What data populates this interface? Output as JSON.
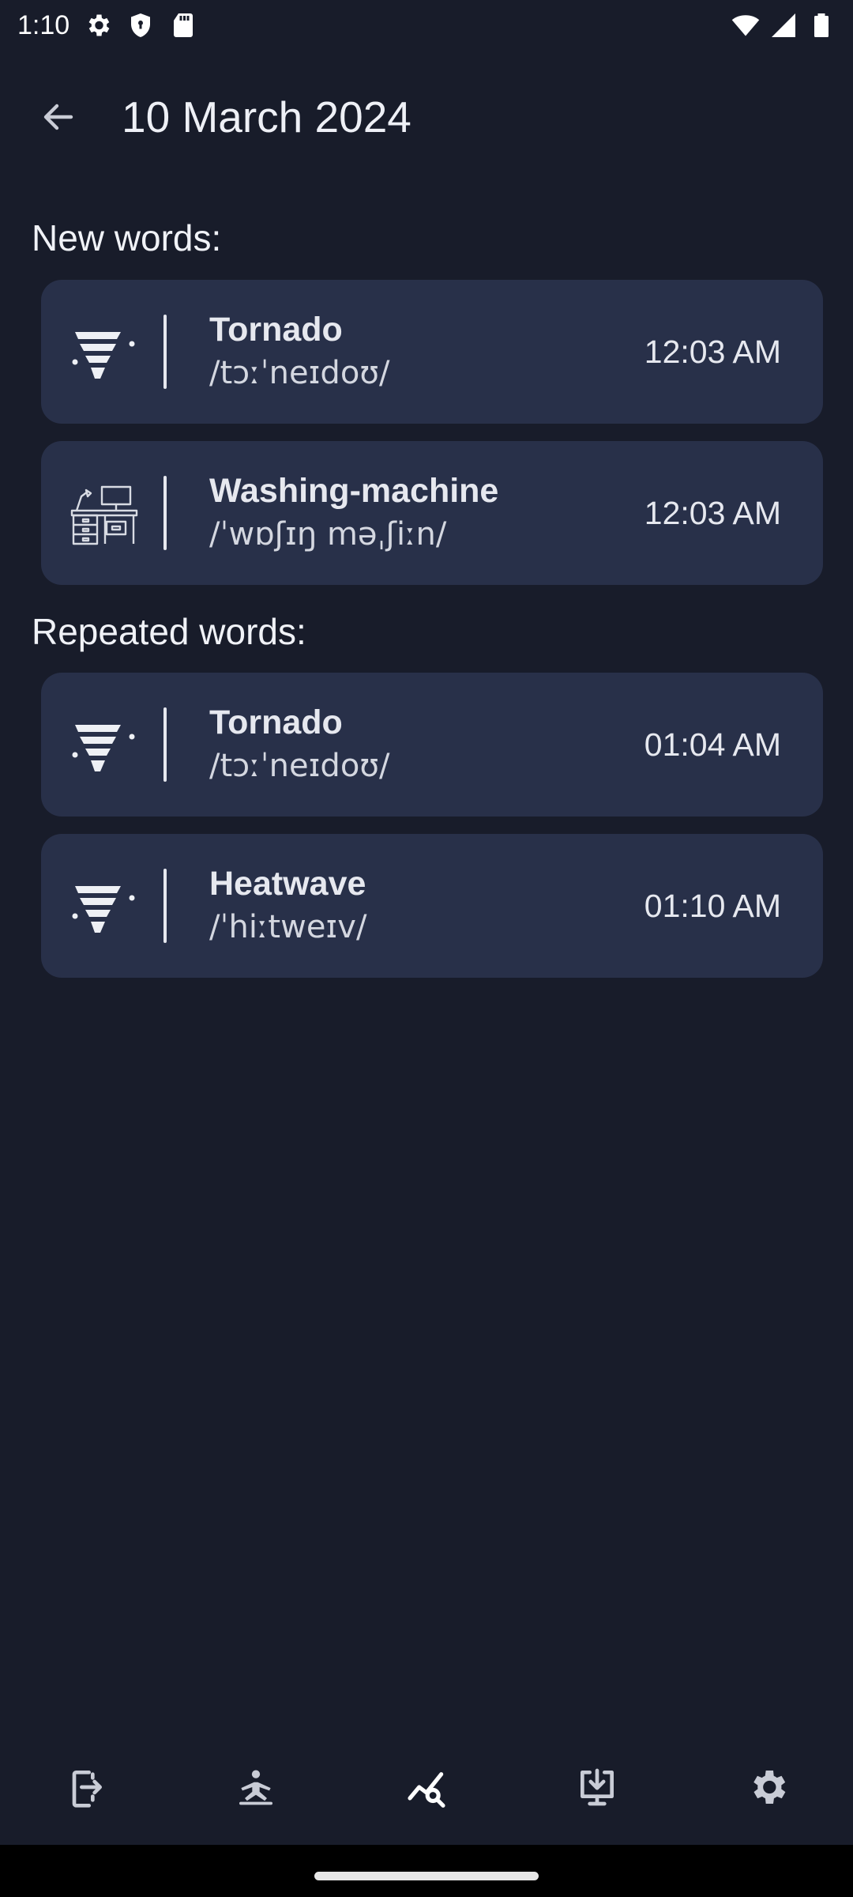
{
  "status_bar": {
    "time": "1:10"
  },
  "header": {
    "title": "10 March 2024"
  },
  "sections": {
    "new_label": "New words:",
    "repeated_label": "Repeated words:"
  },
  "new_words": [
    {
      "word": "Tornado",
      "phonetic": "/tɔːˈneɪdoʊ/",
      "time": "12:03 AM",
      "icon": "tornado-icon"
    },
    {
      "word": "Washing-machine",
      "phonetic": "/ˈwɒʃɪŋ məˌʃiːn/",
      "time": "12:03 AM",
      "icon": "furniture-icon"
    }
  ],
  "repeated_words": [
    {
      "word": "Tornado",
      "phonetic": "/tɔːˈneɪdoʊ/",
      "time": "01:04 AM",
      "icon": "tornado-icon"
    },
    {
      "word": "Heatwave",
      "phonetic": "/ˈhiːtweɪv/",
      "time": "01:10 AM",
      "icon": "tornado-icon"
    }
  ],
  "bottom_nav": [
    {
      "icon": "exit-icon",
      "active": false
    },
    {
      "icon": "exercise-icon",
      "active": false
    },
    {
      "icon": "statistics-icon",
      "active": true
    },
    {
      "icon": "download-icon",
      "active": false
    },
    {
      "icon": "settings-icon",
      "active": false
    }
  ],
  "colors": {
    "background": "#181c2a",
    "card": "#283049",
    "text": "#e6e8ef",
    "nav_inactive": "#c9ccd6",
    "nav_active": "#ffffff"
  }
}
